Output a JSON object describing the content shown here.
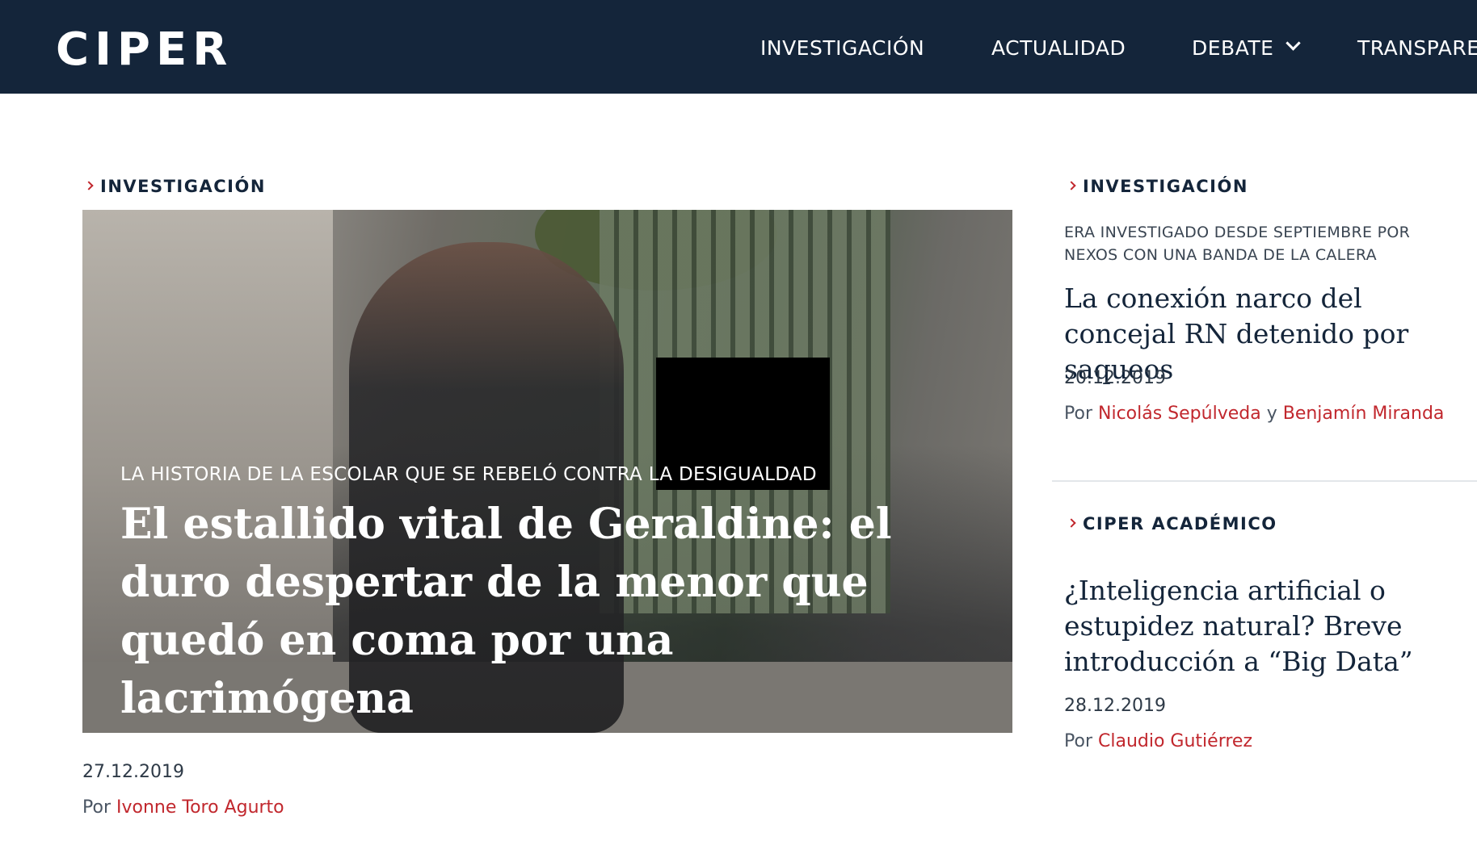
{
  "header": {
    "logo": "CIPER",
    "nav": [
      "INVESTIGACIÓN",
      "ACTUALIDAD",
      "DEBATE",
      "TRANSPARE"
    ]
  },
  "main": {
    "section": "INVESTIGACIÓN",
    "kicker": "LA HISTORIA DE LA ESCOLAR QUE SE REBELÓ CONTRA LA DESIGUALDAD",
    "title": "El estallido vital de Geraldine: el duro despertar de la menor que quedó en coma por una lacrimógena",
    "date": "27.12.2019",
    "by_prefix": "Por",
    "author": "Ivonne Toro Agurto"
  },
  "sidebar": {
    "items": [
      {
        "section": "INVESTIGACIÓN",
        "kicker": "ERA INVESTIGADO DESDE SEPTIEMBRE POR NEXOS CON UNA BANDA DE LA CALERA",
        "title": "La conexión narco del concejal RN detenido por saqueos",
        "date": "20.12.2019",
        "by_prefix": "Por",
        "author": "Nicolás Sepúlveda",
        "joiner": "y",
        "author2": "Benjamín Miranda"
      },
      {
        "section": "CIPER ACADÉMICO",
        "title": "¿Inteligencia artificial o estupidez natural? Breve introducción a “Big Data”",
        "date": "28.12.2019",
        "by_prefix": "Por",
        "author": "Claudio Gutiérrez"
      }
    ]
  },
  "colors": {
    "header_bg": "#14253a",
    "accent_red": "#c1272d",
    "navy_text": "#14253a"
  },
  "icons": {
    "dropdown": "chevron-down-icon",
    "kicker": "chevron-right-icon"
  }
}
